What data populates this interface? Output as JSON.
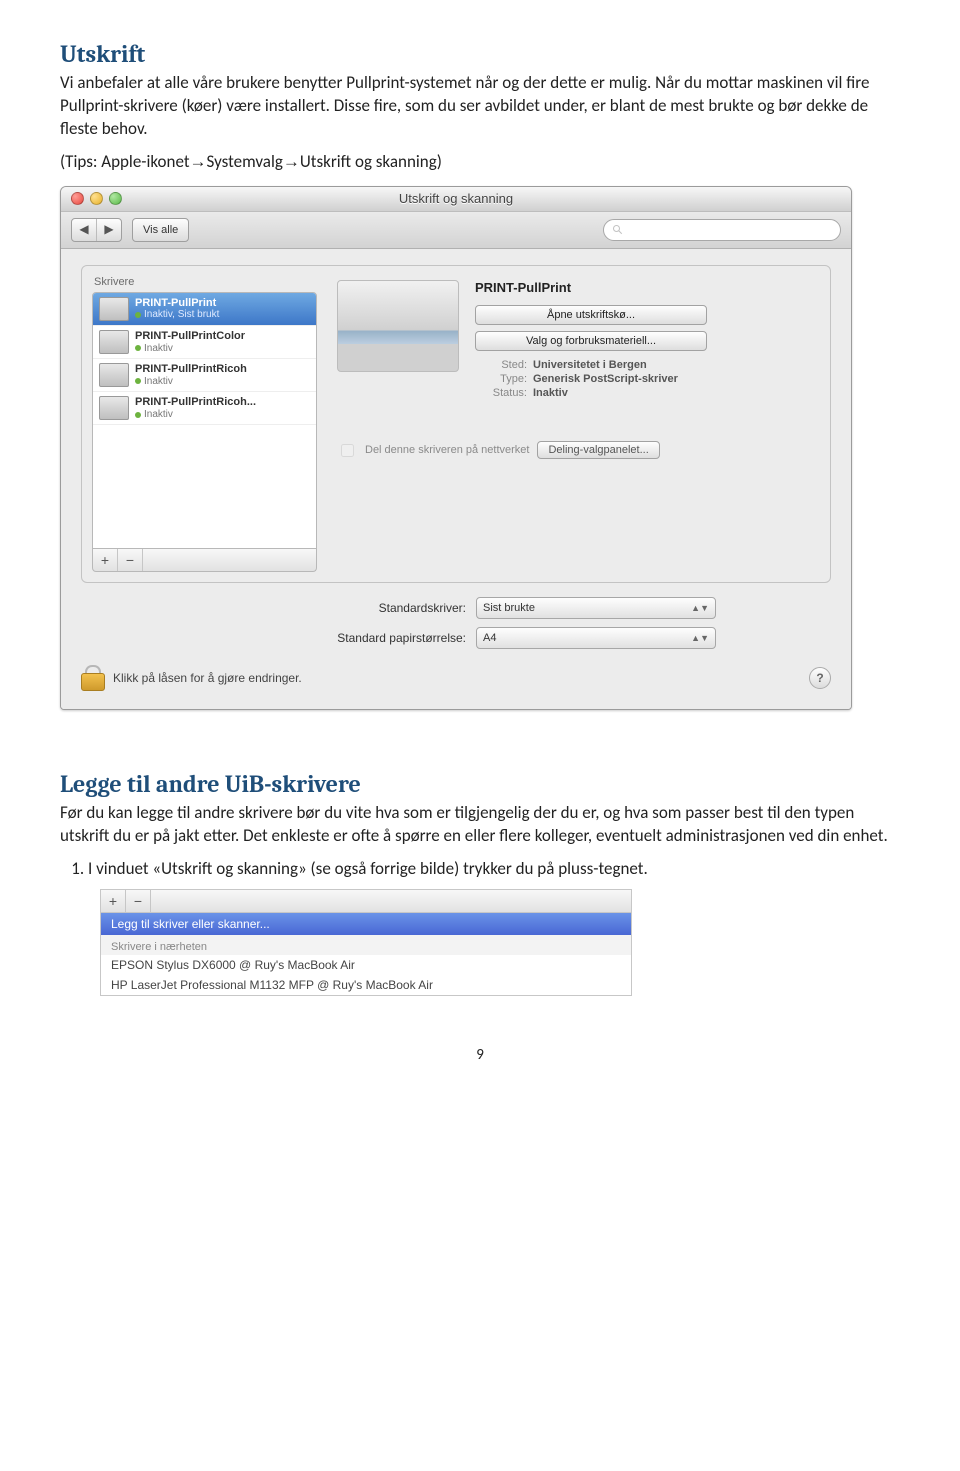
{
  "section1": {
    "title": "Utskrift",
    "para": "Vi anbefaler at alle våre brukere benytter Pullprint-systemet når og der dette er mulig. Når du mottar maskinen vil fire Pullprint-skrivere (køer) være installert. Disse fire, som du ser avbildet under, er blant de mest brukte og bør dekke de fleste behov.",
    "tips_pre": "(Tips: Apple-ikonet",
    "tips_mid1": "Systemvalg",
    "tips_mid2": "Utskrift og skanning)"
  },
  "macwin": {
    "title": "Utskrift og skanning",
    "show_all": "Vis alle",
    "printers_label": "Skrivere",
    "printers": [
      {
        "name": "PRINT-PullPrint",
        "sub": "Inaktiv, Sist brukt",
        "selected": true
      },
      {
        "name": "PRINT-PullPrintColor",
        "sub": "Inaktiv",
        "selected": false
      },
      {
        "name": "PRINT-PullPrintRicoh",
        "sub": "Inaktiv",
        "selected": false
      },
      {
        "name": "PRINT-PullPrintRicoh...",
        "sub": "Inaktiv",
        "selected": false
      }
    ],
    "big_name": "PRINT-PullPrint",
    "btn_queue": "Åpne utskriftskø...",
    "btn_supply": "Valg og forbruksmateriell...",
    "meta": {
      "sted_lbl": "Sted:",
      "sted": "Universitetet i Bergen",
      "type_lbl": "Type:",
      "type": "Generisk PostScript-skriver",
      "status_lbl": "Status:",
      "status": "Inaktiv"
    },
    "share_label": "Del denne skriveren på nettverket",
    "share_btn": "Deling-valgpanelet...",
    "defaults": {
      "std_printer_lbl": "Standardskriver:",
      "std_printer": "Sist brukte",
      "std_paper_lbl": "Standard papirstørrelse:",
      "std_paper": "A4"
    },
    "lock_text": "Klikk på låsen for å gjøre endringer."
  },
  "section2": {
    "title": "Legge til andre UiB-skrivere",
    "para": "Før du kan legge til andre skrivere bør du vite hva som er tilgjengelig der du er, og hva som passer best til den typen utskrift du er på jakt etter. Det enkleste er ofte å spørre en eller flere kolleger, eventuelt administrasjonen ved din enhet.",
    "step1": "I vinduet «Utskrift og skanning» (se også forrige bilde) trykker du på pluss-tegnet."
  },
  "mini": {
    "add": "Legg til skriver eller skanner...",
    "near": "Skrivere i nærheten",
    "opt1": "EPSON Stylus DX6000 @ Ruy's MacBook Air",
    "opt2": "HP LaserJet Professional M1132 MFP @ Ruy's MacBook Air"
  },
  "page": "9"
}
